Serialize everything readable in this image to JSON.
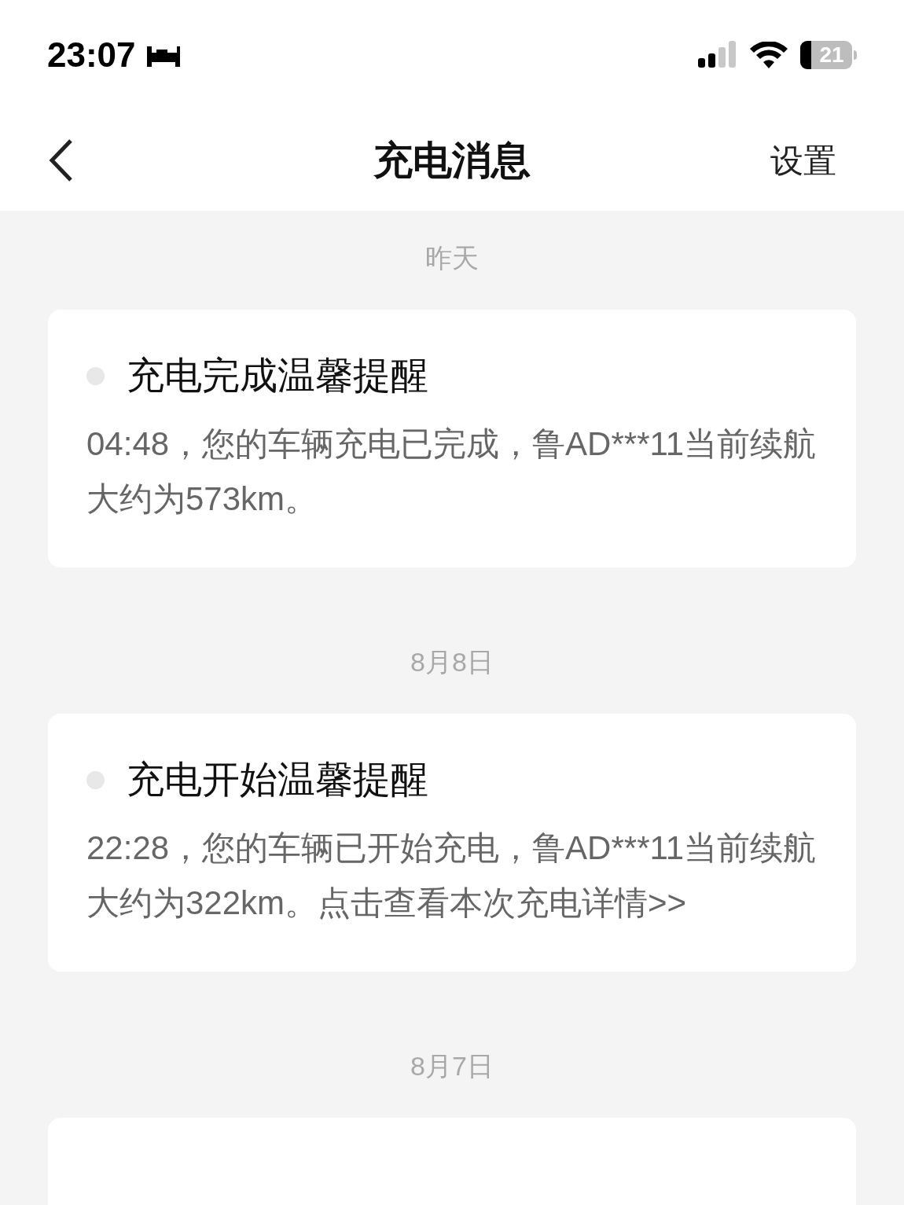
{
  "status_bar": {
    "time": "23:07",
    "battery": "21"
  },
  "header": {
    "title": "充电消息",
    "action": "设置"
  },
  "groups": [
    {
      "date": "昨天",
      "messages": [
        {
          "title": "充电完成温馨提醒",
          "read": true,
          "body": "04:48，您的车辆充电已完成，鲁AD***11当前续航大约为573km。"
        }
      ]
    },
    {
      "date": "8月8日",
      "messages": [
        {
          "title": "充电开始温馨提醒",
          "read": true,
          "body": "22:28，您的车辆已开始充电，鲁AD***11当前续航大约为322km。点击查看本次充电详情>>"
        }
      ]
    },
    {
      "date": "8月7日"
    }
  ]
}
